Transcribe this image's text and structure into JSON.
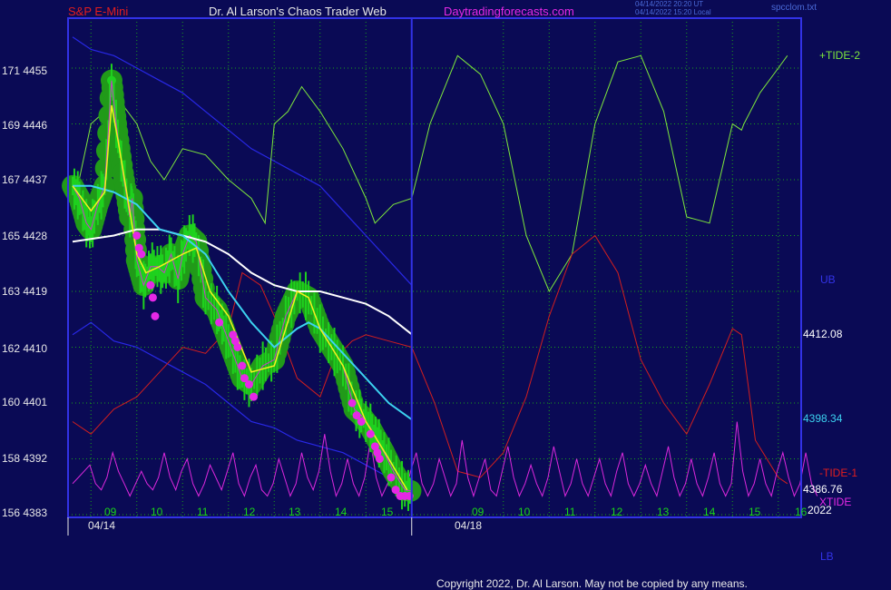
{
  "header": {
    "symbol": "S&P E-Mini",
    "title": "Dr. Al Larson's Chaos Trader Web",
    "site": "Daytradingforecasts.com",
    "timestamp_ut": "04/14/2022 20:20 UT",
    "timestamp_local": "04/14/2022 15:20 Local",
    "filename": "spcclom.txt"
  },
  "colors": {
    "background": "#0a0a55",
    "grid": "#19a019",
    "price_bars": "#1ed21e",
    "price_glow": "#219a19",
    "fast_ma": "#f5f01e",
    "medium_ma": "#3cd2f0",
    "slow_ma": "#ffffff",
    "tide_plus": "#7ee83c",
    "tide_minus": "#d21e1e",
    "xtide": "#dc28dc",
    "band": "#2828e6",
    "marker": "#e628e6"
  },
  "y_axis": {
    "labels": [
      {
        "price": 4455,
        "text": "171  4455"
      },
      {
        "price": 4446,
        "text": "169  4446"
      },
      {
        "price": 4437,
        "text": "167  4437"
      },
      {
        "price": 4428,
        "text": "165  4428"
      },
      {
        "price": 4419,
        "text": "163  4419"
      },
      {
        "price": 4410,
        "text": "162  4410"
      },
      {
        "price": 4401,
        "text": "160  4401"
      },
      {
        "price": 4392,
        "text": "158  4392"
      },
      {
        "price": 4383,
        "text": "156  4383"
      }
    ]
  },
  "x_axis": {
    "day1_hours": [
      "09",
      "10",
      "11",
      "12",
      "13",
      "14",
      "15"
    ],
    "day2_hours": [
      "09",
      "10",
      "11",
      "12",
      "13",
      "14",
      "15",
      "16"
    ],
    "date1": "04/14",
    "date2": "04/18"
  },
  "right_labels": {
    "tide_plus": "+TIDE-2",
    "ub": "UB",
    "slow_ma_value": "4412.08",
    "medium_ma_value": "4398.34",
    "tide_minus": "-TIDE-1",
    "price_value": "4386.76",
    "xtide": "XTIDE",
    "year": "2022",
    "lb": "LB"
  },
  "copyright": "Copyright 2022, Dr. Al Larson. May not be copied by any means.",
  "chart_data": {
    "type": "line",
    "x_range_hours": [
      8.5,
      24.5
    ],
    "now_hour": 16.0,
    "ylim": [
      4383,
      4460
    ],
    "price": {
      "name": "S&P E-Mini",
      "x": [
        8.6,
        8.75,
        8.9,
        9.0,
        9.15,
        9.3,
        9.45,
        9.55,
        9.7,
        9.85,
        9.9,
        10.0,
        10.15,
        10.3,
        10.45,
        10.6,
        10.75,
        10.9,
        11.0,
        11.15,
        11.3,
        11.5,
        11.75,
        11.9,
        12.1,
        12.3,
        12.5,
        12.75,
        13.0,
        13.25,
        13.5,
        13.75,
        14.0,
        14.25,
        14.5,
        14.75,
        14.9,
        15.1,
        15.25,
        15.4,
        15.6,
        15.85,
        16.0
      ],
      "values": [
        4436,
        4434,
        4430,
        4429,
        4433,
        4436,
        4453,
        4446,
        4438,
        4431,
        4434,
        4424,
        4420,
        4423,
        4423,
        4422,
        4425,
        4421,
        4425,
        4428,
        4427,
        4418,
        4416,
        4413,
        4409,
        4405,
        4404,
        4407,
        4408,
        4415,
        4419,
        4418,
        4413,
        4410,
        4407,
        4400,
        4399,
        4397,
        4395,
        4393,
        4390,
        4387,
        4386.8
      ]
    },
    "fast_ma": {
      "x": [
        8.6,
        9.0,
        9.3,
        9.45,
        9.6,
        9.8,
        10.0,
        10.2,
        10.5,
        11.0,
        11.3,
        11.6,
        12.0,
        12.5,
        13.0,
        13.5,
        13.75,
        14.0,
        14.5,
        15.0,
        15.5,
        15.9
      ],
      "values": [
        4436,
        4432,
        4435,
        4449,
        4443,
        4434,
        4425,
        4422,
        4423,
        4425,
        4426,
        4419,
        4415,
        4406,
        4407,
        4419,
        4418,
        4413,
        4407,
        4398,
        4392,
        4387
      ]
    },
    "medium_ma": {
      "x": [
        8.6,
        9.0,
        9.5,
        10.0,
        10.5,
        11.0,
        11.5,
        12.0,
        12.5,
        13.0,
        13.5,
        13.75,
        14.0,
        14.5,
        15.0,
        15.5,
        16.0
      ],
      "values": [
        4436,
        4436,
        4435,
        4433,
        4429,
        4428,
        4425,
        4419,
        4414,
        4410,
        4413,
        4414,
        4413,
        4409,
        4405,
        4401,
        4398.34
      ]
    },
    "slow_ma": {
      "x": [
        8.6,
        9.5,
        10.0,
        10.5,
        11.0,
        11.5,
        12.0,
        12.5,
        13.0,
        13.5,
        14.0,
        14.5,
        15.0,
        15.5,
        16.0
      ],
      "values": [
        4427,
        4428,
        4429,
        4429,
        4428,
        4427,
        4425,
        4422,
        4420,
        4419,
        4419,
        4418,
        4417,
        4415,
        4412.08
      ]
    },
    "upper_band": {
      "x": [
        8.6,
        9.0,
        9.5,
        10.0,
        10.5,
        11.0,
        11.5,
        12.0,
        12.5,
        13.0,
        13.5,
        14.0,
        14.5,
        15.0,
        15.5,
        16.0
      ],
      "values": [
        4460,
        4458,
        4457,
        4455,
        4453,
        4451,
        4448,
        4445,
        4442,
        4440,
        4438,
        4436,
        4432,
        4428,
        4424,
        4420
      ]
    },
    "lower_band": {
      "x": [
        8.6,
        9.0,
        9.5,
        10.0,
        10.5,
        11.0,
        11.5,
        12.0,
        12.5,
        13.0,
        13.5,
        14.0,
        14.5,
        15.0,
        15.5,
        16.0
      ],
      "values": [
        4412,
        4414,
        4411,
        4410,
        4408,
        4406,
        4404,
        4401,
        4398,
        4397,
        4395,
        4394,
        4393,
        4391,
        4389,
        4387
      ]
    },
    "tide_plus": {
      "name": "+TIDE-2",
      "x": [
        8.6,
        9.0,
        9.6,
        10.0,
        10.3,
        10.6,
        11.0,
        11.5,
        12.0,
        12.5,
        12.8,
        13.0,
        13.3,
        13.6,
        14.0,
        14.5,
        15.0,
        15.2,
        15.6,
        16.0,
        16.4,
        17.0,
        17.5,
        18.0,
        18.5,
        19.0,
        19.5,
        20.0,
        20.5,
        21.0,
        21.5,
        22.0,
        22.5,
        23.0,
        23.2,
        23.25,
        23.6,
        24.0,
        24.2
      ],
      "values": [
        4432,
        4446,
        4450,
        4446,
        4440,
        4437,
        4442,
        4441,
        4437,
        4434,
        4430,
        4446,
        4448,
        4452,
        4448,
        4442,
        4434,
        4430,
        4433,
        4434,
        4446,
        4457,
        4454,
        4446,
        4428,
        4419,
        4425,
        4446,
        4456,
        4457,
        4448,
        4431,
        4430,
        4446,
        4445,
        4446,
        4451,
        4455,
        4457
      ]
    },
    "tide_minus": {
      "name": "-TIDE-1",
      "x": [
        8.6,
        9.0,
        9.5,
        10.0,
        10.5,
        11.0,
        11.5,
        12.0,
        12.3,
        12.7,
        13.0,
        13.5,
        14.0,
        14.3,
        14.7,
        15.0,
        15.5,
        16.0,
        16.5,
        17.0,
        17.5,
        18.0,
        18.5,
        19.0,
        19.5,
        20.0,
        20.5,
        21.0,
        21.5,
        22.0,
        22.5,
        23.0,
        23.2,
        23.5,
        24.0,
        24.2
      ],
      "values": [
        4398,
        4396,
        4400,
        4402,
        4406,
        4410,
        4409,
        4413,
        4422,
        4420,
        4415,
        4405,
        4402,
        4408,
        4411,
        4412,
        4411,
        4410,
        4401,
        4390,
        4389,
        4393,
        4402,
        4415,
        4425,
        4428,
        4422,
        4408,
        4401,
        4396,
        4404,
        4413,
        4412,
        4395,
        4389,
        4388
      ]
    },
    "xtide": {
      "name": "XTIDE",
      "x_start": 8.6,
      "x_step": 0.125,
      "values": [
        4388,
        4389,
        4390,
        4391,
        4388,
        4387,
        4389,
        4393,
        4390,
        4388,
        4386,
        4388,
        4390,
        4388,
        4387,
        4389,
        4393,
        4389,
        4387,
        4390,
        4392,
        4388,
        4386,
        4388,
        4391,
        4389,
        4387,
        4390,
        4393,
        4388,
        4386,
        4389,
        4391,
        4387,
        4386,
        4388,
        4392,
        4389,
        4386,
        4388,
        4393,
        4389,
        4387,
        4390,
        4396,
        4390,
        4386,
        4388,
        4392,
        4388,
        4386,
        4389,
        4395,
        4389,
        4386,
        4388,
        4392,
        4388,
        4386,
        4390,
        4393,
        4388,
        4386,
        4388,
        4392,
        4389,
        4386,
        4388,
        4395,
        4389,
        4386,
        4389,
        4392,
        4387,
        4386,
        4390,
        4394,
        4389,
        4386,
        4388,
        4391,
        4388,
        4386,
        4389,
        4394,
        4390,
        4386,
        4388,
        4392,
        4388,
        4386,
        4389,
        4392,
        4388,
        4386,
        4390,
        4393,
        4388,
        4386,
        4388,
        4391,
        4388,
        4386,
        4390,
        4394,
        4389,
        4386,
        4388,
        4392,
        4388,
        4386,
        4389,
        4393,
        4388,
        4386,
        4388,
        4398,
        4390,
        4386,
        4388,
        4392,
        4388,
        4386,
        4390,
        4393,
        4389,
        4386,
        4388,
        4393,
        4388,
        4386
      ]
    },
    "markers": {
      "x": [
        10.0,
        10.05,
        10.1,
        10.3,
        10.35,
        10.4,
        11.8,
        12.1,
        12.15,
        12.2,
        12.3,
        12.35,
        12.45,
        12.55,
        14.7,
        14.8,
        14.9,
        15.1,
        15.2,
        15.25,
        15.3,
        15.55,
        15.65,
        15.75,
        15.85,
        15.95
      ],
      "values": [
        4428,
        4426,
        4425,
        4420,
        4418,
        4415,
        4414,
        4412,
        4411,
        4410,
        4407,
        4405,
        4404,
        4402,
        4401,
        4399,
        4398,
        4396,
        4394,
        4393,
        4392,
        4389,
        4387,
        4386,
        4386,
        4386
      ]
    }
  }
}
